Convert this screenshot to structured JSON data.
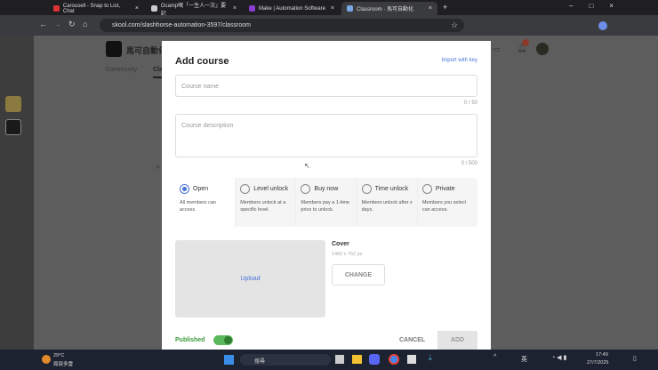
{
  "browser": {
    "tabs": [
      {
        "label": "Carousell - Snap to List, Chat"
      },
      {
        "label": "Ocamp嘅「一生人一次」要記"
      },
      {
        "label": "Make | Automation Software"
      },
      {
        "label": "Classroom · 馬可自動化",
        "active": true
      }
    ],
    "url": "skool.com/slashhorse-automation-3597/classroom"
  },
  "community": {
    "name": "馬可自動化",
    "tabs": [
      "Community",
      "Cla"
    ]
  },
  "modal": {
    "title": "Add course",
    "import_link": "Import with key",
    "course_name_placeholder": "Course name",
    "course_name_count": "0 / 50",
    "course_description_placeholder": "Course description",
    "course_description_count": "0 / 500",
    "access_options": [
      {
        "label": "Open",
        "description": "All members can access.",
        "selected": true
      },
      {
        "label": "Level unlock",
        "description": "Members unlock at a specific level."
      },
      {
        "label": "Buy now",
        "description": "Members pay a 1-time price to unlock."
      },
      {
        "label": "Time unlock",
        "description": "Members unlock after x days."
      },
      {
        "label": "Private",
        "description": "Members you select can access."
      }
    ],
    "upload_label": "Upload",
    "cover_label": "Cover",
    "cover_size": "1460 x 752 px",
    "change_button": "CHANGE",
    "published_label": "Published",
    "published": true,
    "cancel_button": "CANCEL",
    "add_button": "ADD"
  },
  "taskbar": {
    "weather_temp": "29°C",
    "weather_desc": "局部多雲",
    "search_placeholder": "搜尋",
    "time": "17:49",
    "date": "27/7/2025",
    "ime": "英"
  }
}
